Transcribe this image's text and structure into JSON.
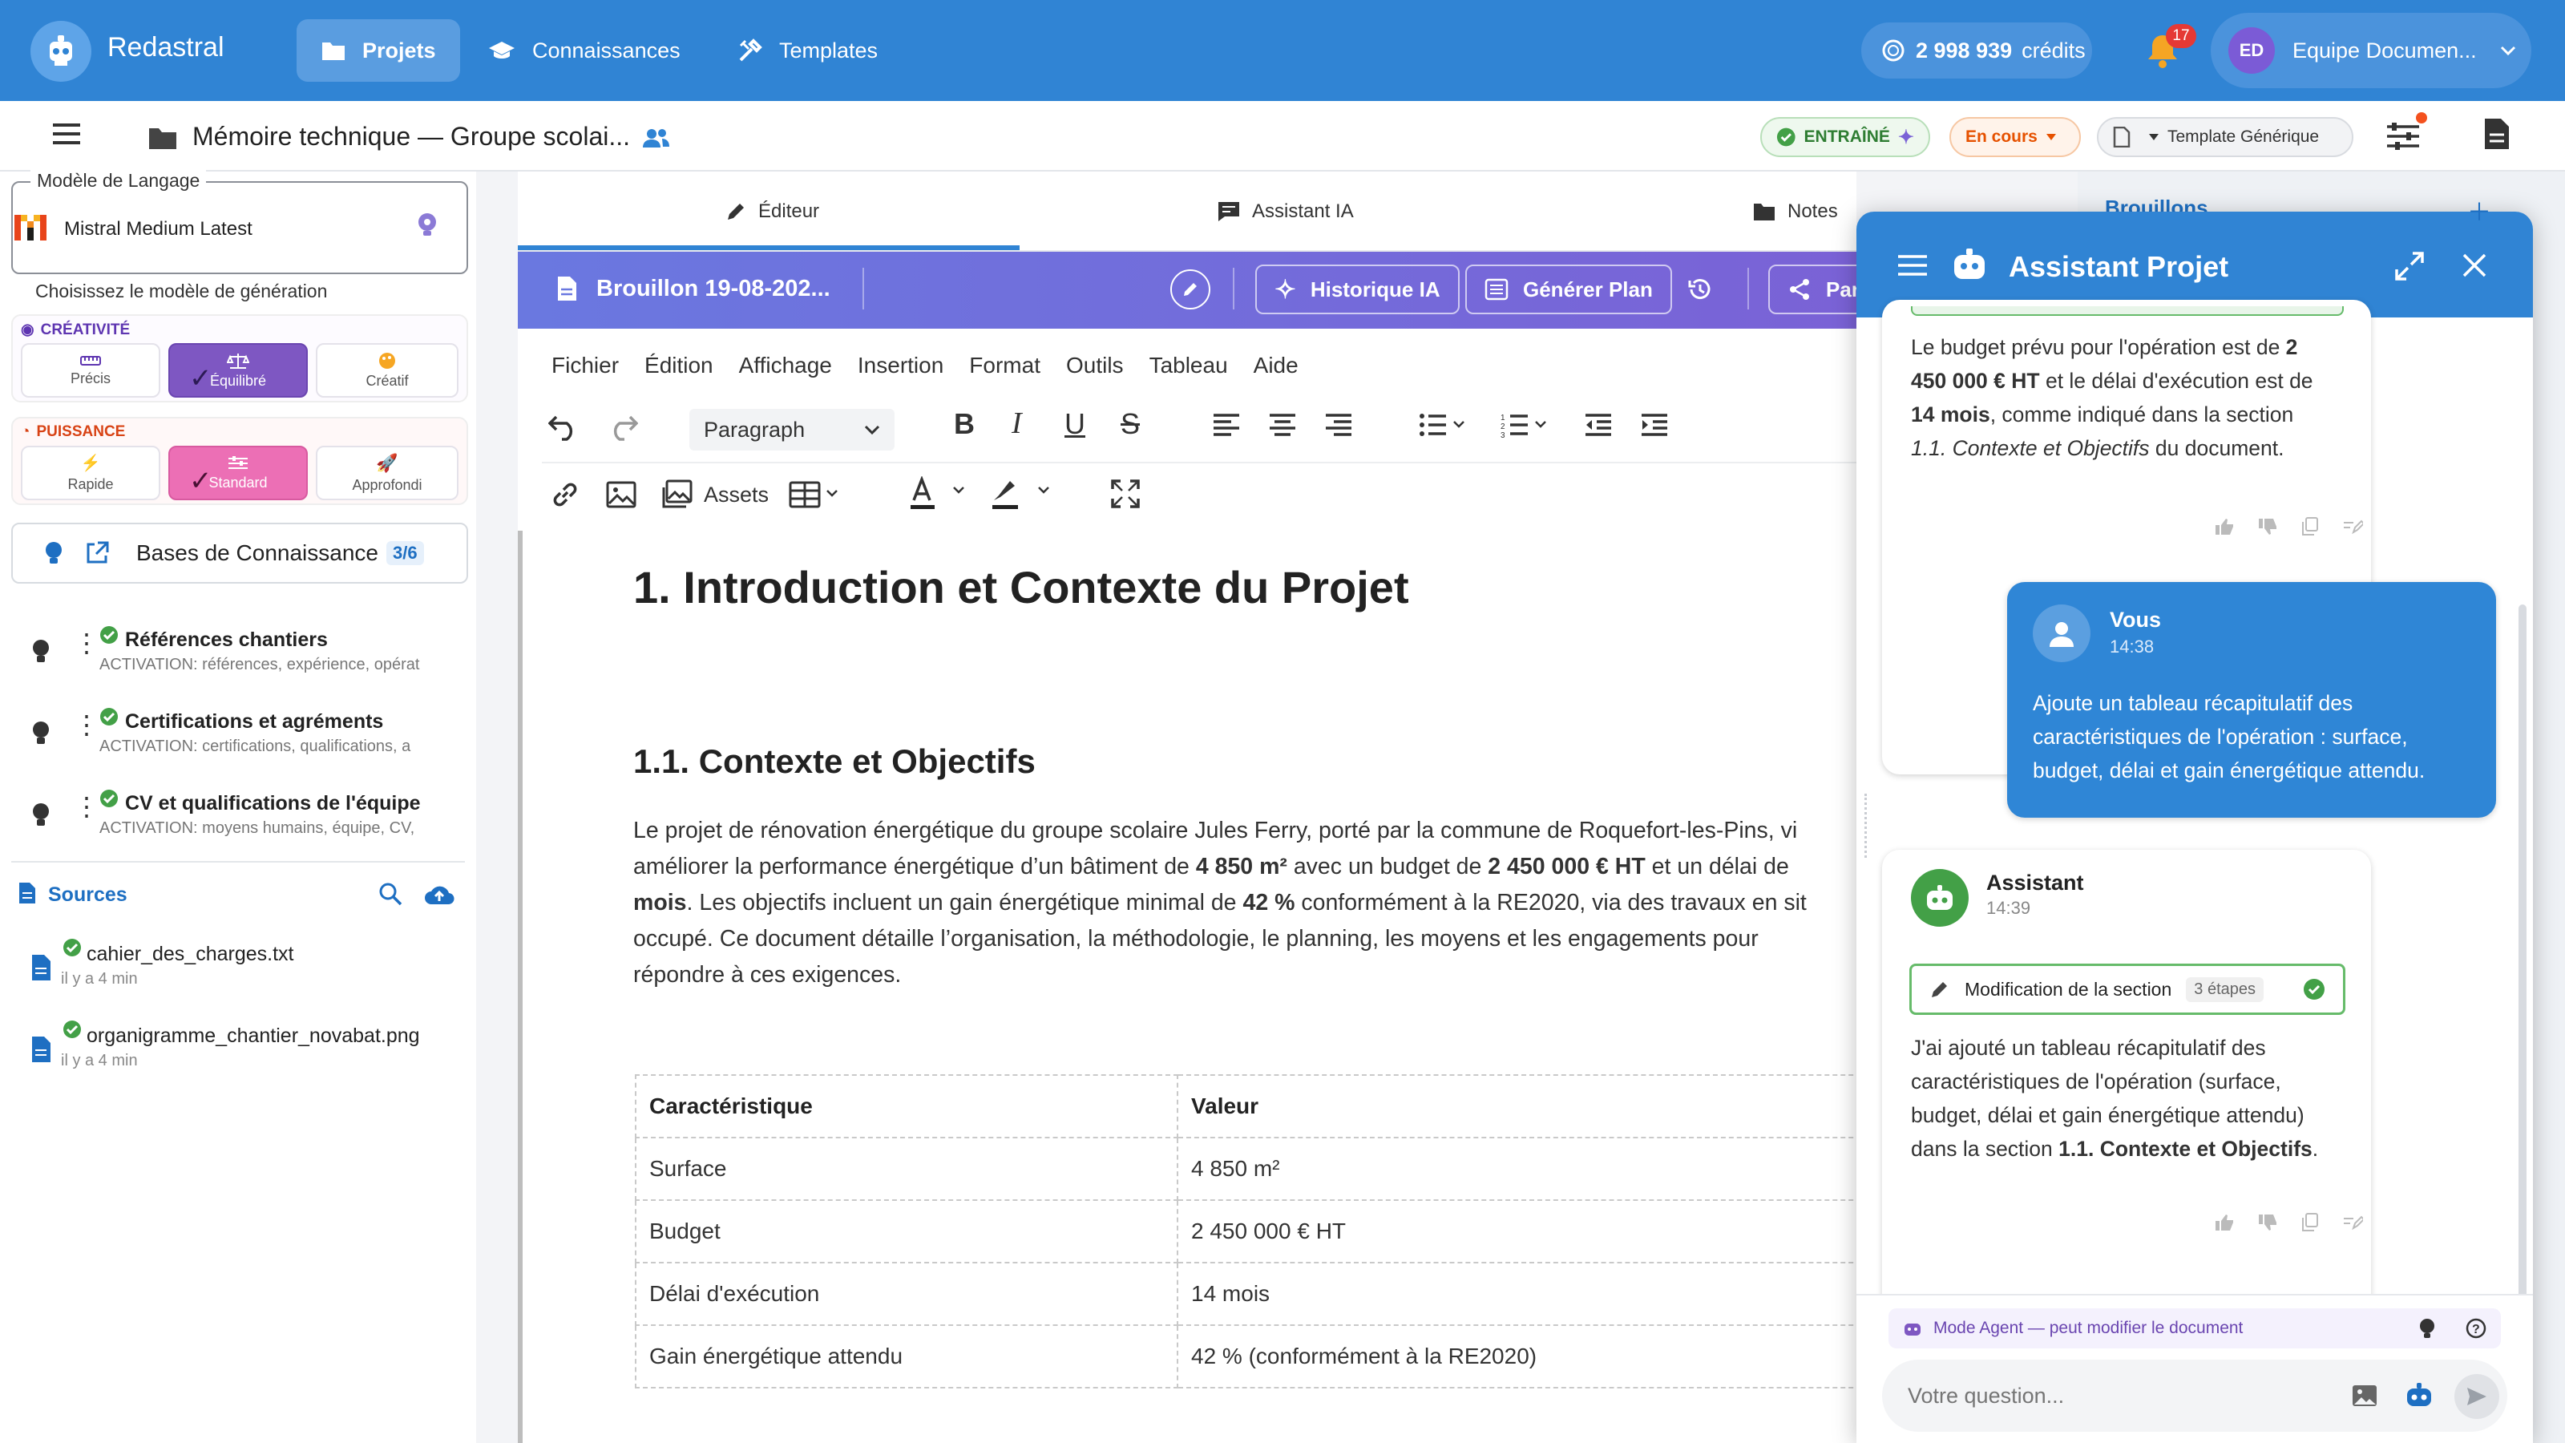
{
  "topbar": {
    "brand": "Redastral",
    "nav": [
      {
        "label": "Projets",
        "icon": "folder-icon",
        "active": true
      },
      {
        "label": "Connaissances",
        "icon": "graduation-cap-icon",
        "active": false
      },
      {
        "label": "Templates",
        "icon": "tools-icon",
        "active": false
      }
    ],
    "credits_amount": "2 998 939",
    "credits_label": "crédits",
    "notifications_count": "17",
    "user_initials": "ED",
    "user_name": "Equipe Documen..."
  },
  "subbar": {
    "doc_title": "Mémoire technique — Groupe scolai...",
    "trained_label": "ENTRAÎNÉ",
    "status_label": "En cours",
    "template_label": "Template Générique"
  },
  "left": {
    "model_legend": "Modèle de Langage",
    "model_value": "Mistral Medium Latest",
    "model_hint": "Choisissez le modèle de génération",
    "creativity_title": "CRÉATIVITÉ",
    "creativity_options": [
      "Précis",
      "Équilibré",
      "Créatif"
    ],
    "power_title": "PUISSANCE",
    "power_options": [
      "Rapide",
      "Standard",
      "Approfondi"
    ],
    "kb_button_label": "Bases de Connaissance",
    "kb_count": "3/6",
    "kb_items": [
      {
        "title": "Références chantiers",
        "sub": "ACTIVATION: références, expérience, opérat"
      },
      {
        "title": "Certifications et agréments",
        "sub": "ACTIVATION: certifications, qualifications, a"
      },
      {
        "title": "CV et qualifications de l'équipe",
        "sub": "ACTIVATION: moyens humains, équipe, CV,"
      }
    ],
    "sources_title": "Sources",
    "sources": [
      {
        "name": "cahier_des_charges.txt",
        "time": "il y a 4 min"
      },
      {
        "name": "organigramme_chantier_novabat.png",
        "time": "il y a 4 min"
      }
    ]
  },
  "editor": {
    "tabs": [
      "Éditeur",
      "Assistant IA",
      "Notes"
    ],
    "draft_title": "Brouillon 19-08-202...",
    "history_btn": "Historique IA",
    "plan_btn": "Générer Plan",
    "share_btn": "Par",
    "menu": [
      "Fichier",
      "Édition",
      "Affichage",
      "Insertion",
      "Format",
      "Outils",
      "Tableau",
      "Aide"
    ],
    "block_format": "Paragraph",
    "assets_label": "Assets",
    "h1": "1. Introduction et Contexte du Projet",
    "h2": "1.1. Contexte et Objectifs",
    "p1_a": "Le projet de rénovation énergétique du groupe scolaire Jules Ferry, porté par la commune de Roquefort-les-Pins, vi",
    "p2_a": "améliorer la performance énergétique d’un bâtiment de ",
    "p2_b": "4 850 m²",
    "p2_c": " avec un budget de ",
    "p2_d": "2 450 000 € HT",
    "p2_e": " et un délai de",
    "p3_a": "mois",
    "p3_b": ". Les objectifs incluent un gain énergétique minimal de ",
    "p3_c": "42 %",
    "p3_d": " conformément à la RE2020, via des travaux en sit",
    "p4": "occupé. Ce document détaille l’organisation, la méthodologie, le planning, les moyens et les engagements pour",
    "p5": "répondre à ces exigences.",
    "table": [
      [
        "Caractéristique",
        "Valeur"
      ],
      [
        "Surface",
        "4 850 m²"
      ],
      [
        "Budget",
        "2 450 000 € HT"
      ],
      [
        "Délai d'exécution",
        "14 mois"
      ],
      [
        "Gain énergétique attendu",
        "42 % (conformément à la RE2020)"
      ]
    ]
  },
  "rightstrip": {
    "label": "Brouillons"
  },
  "assistant": {
    "title": "Assistant Projet",
    "msg1_l1a": "Le budget prévu pour l'opération est de ",
    "msg1_l1b": "2",
    "msg1_l2a": "450 000 € HT",
    "msg1_l2b": " et le délai d'exécution est de",
    "msg1_l3a": "14 mois",
    "msg1_l3b": ", comme indiqué dans la section",
    "msg1_l4a": "1.1. Contexte et Objectifs",
    "msg1_l4b": " du document.",
    "user_name": "Vous",
    "user_time": "14:38",
    "user_l1": "Ajoute un tableau récapitulatif des",
    "user_l2": "caractéristiques de l'opération : surface,",
    "user_l3": "budget, délai et gain énergétique attendu.",
    "bot_name": "Assistant",
    "bot_time": "14:39",
    "step_label": "Modification de la section",
    "step_count": "3 étapes",
    "bot_l1": "J'ai ajouté un tableau récapitulatif des",
    "bot_l2": "caractéristiques de l'opération (surface,",
    "bot_l3": "budget, délai et gain énergétique attendu)",
    "bot_l4a": "dans la section ",
    "bot_l4b": "1.1. Contexte et Objectifs",
    "bot_l4c": ".",
    "mode_label": "Mode Agent — peut modifier le document",
    "input_placeholder": "Votre question..."
  },
  "colors": {
    "primary": "#3084d4",
    "purple": "#7a62d6",
    "pink": "#e86bb8",
    "green": "#43a047"
  }
}
